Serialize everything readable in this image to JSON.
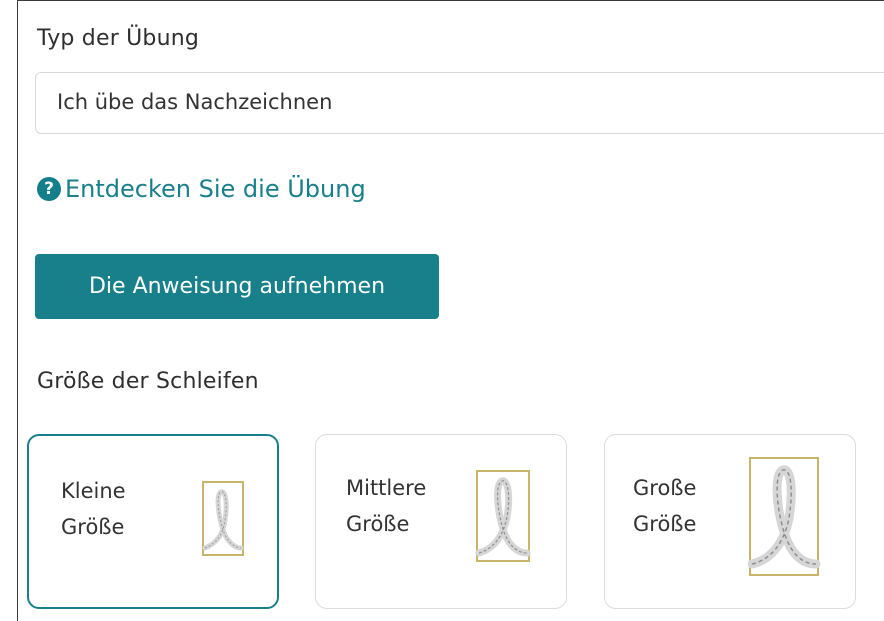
{
  "exercise_type": {
    "label": "Typ der Übung",
    "selected_value": "Ich übe das Nachzeichnen"
  },
  "discover_link": {
    "icon": "question-circle-icon",
    "label": "Entdecken Sie die Übung"
  },
  "record_button": {
    "label": "Die Anweisung aufnehmen"
  },
  "loop_size": {
    "label": "Größe der Schleifen",
    "options": [
      {
        "line1": "Kleine",
        "line2": "Größe",
        "selected": true
      },
      {
        "line1": "Mittlere",
        "line2": "Größe",
        "selected": false
      },
      {
        "line1": "Große",
        "line2": "Größe",
        "selected": false
      }
    ]
  },
  "colors": {
    "accent": "#17808b",
    "loop_frame": "#c8b56a",
    "loop_fill": "#d6d6d6"
  }
}
